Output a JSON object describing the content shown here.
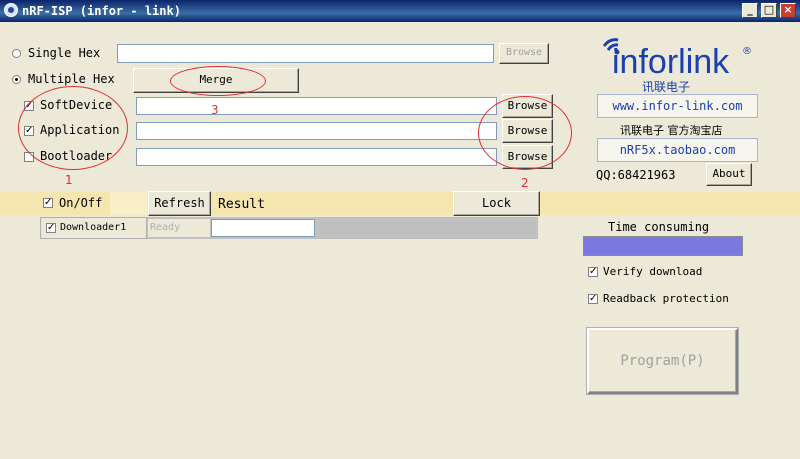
{
  "window": {
    "title": "nRF-ISP (infor - link)"
  },
  "title_buttons": {
    "minimize": "_",
    "maximize": "□",
    "close": "×"
  },
  "files": {
    "single_hex_label": "Single Hex",
    "multiple_hex_label": "Multiple Hex",
    "merge_label": "Merge",
    "browse_label": "Browse",
    "softdevice_label": "SoftDevice",
    "application_label": "Application",
    "bootloader_label": "Bootloader"
  },
  "annotations": {
    "n1": "1",
    "n2": "2",
    "n3": "3"
  },
  "toolbar": {
    "onoff_label": "On/Off",
    "refresh_label": "Refresh",
    "result_label": "Result",
    "lock_label": "Lock"
  },
  "downloader": {
    "name": "Downloader1",
    "status": "Ready"
  },
  "brand": {
    "logo_text": "inforlink",
    "logo_mark": "®",
    "logo_cn": "讯联电子",
    "website": "www.infor-link.com",
    "shop_label": "讯联电子 官方淘宝店",
    "taobao": "nRF5x.taobao.com",
    "qq": "QQ:68421963",
    "about_label": "About"
  },
  "options": {
    "time_consuming_label": "Time consuming",
    "verify_label": "Verify download",
    "readback_label": "Readback protection",
    "program_label": "Program(P)"
  },
  "colors": {
    "accent_band": "#f5e6b0",
    "progress": "#7b78e0",
    "annotation": "#e03030"
  }
}
